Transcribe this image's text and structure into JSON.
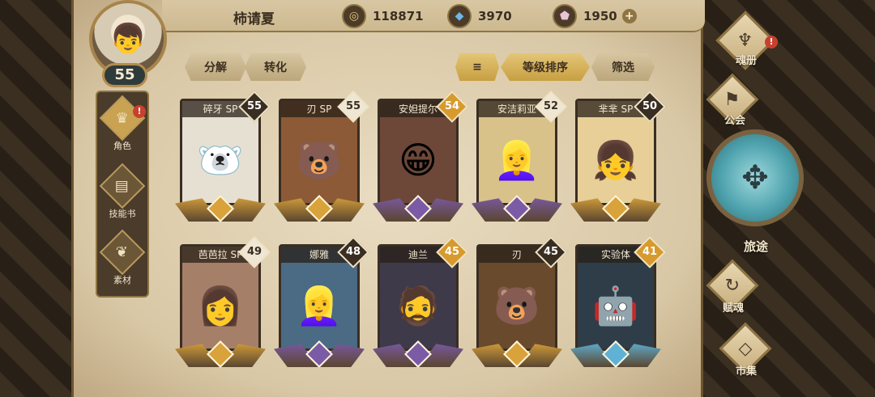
{
  "player": {
    "name": "柿请夏",
    "level": "55"
  },
  "currencies": [
    {
      "icon": "gold-coin-icon",
      "value": "118871"
    },
    {
      "icon": "blue-crystal-icon",
      "value": "3970"
    },
    {
      "icon": "pink-gem-icon",
      "value": "1950"
    }
  ],
  "left_menu": [
    {
      "label": "角色",
      "icon": "character-icon",
      "alert": "!"
    },
    {
      "label": "技能书",
      "icon": "skill-book-icon"
    },
    {
      "label": "素材",
      "icon": "material-icon"
    }
  ],
  "toolbar": {
    "decompose": "分解",
    "convert": "转化",
    "sort_level": "等级排序",
    "filter": "筛选"
  },
  "heroes": [
    {
      "name": "碎牙 SP",
      "level": "55",
      "level_color": "#3a2e22",
      "rarity": "gold",
      "bg": "#e6e0d2",
      "glyph": "🐻‍❄"
    },
    {
      "name": "刃 SP",
      "level": "55",
      "level_color": "#efe7d4",
      "rarity": "gold",
      "bg": "#8c5a36",
      "glyph": "🐻"
    },
    {
      "name": "安妲提尔",
      "level": "54",
      "level_color": "#d79a2c",
      "rarity": "purple",
      "bg": "#6d4738",
      "glyph": "😁"
    },
    {
      "name": "安洁莉亚",
      "level": "52",
      "level_color": "#efe7d4",
      "rarity": "purple",
      "bg": "#d9c18a",
      "glyph": "👱‍♀"
    },
    {
      "name": "芈芈 SP",
      "level": "50",
      "level_color": "#3a2e22",
      "rarity": "gold",
      "bg": "#e7cf97",
      "glyph": "👧"
    },
    {
      "name": "芭芭拉 SP",
      "level": "49",
      "level_color": "#efe7d4",
      "rarity": "gold",
      "bg": "#a67f68",
      "glyph": "👩"
    },
    {
      "name": "娜雅",
      "level": "48",
      "level_color": "#3a2e22",
      "rarity": "purple",
      "bg": "#4b6a84",
      "glyph": "👱‍♀"
    },
    {
      "name": "迪兰",
      "level": "45",
      "level_color": "#d79a2c",
      "rarity": "purple",
      "bg": "#3e3a4a",
      "glyph": "🧔"
    },
    {
      "name": "刃",
      "level": "45",
      "level_color": "#3a2e22",
      "rarity": "gold",
      "bg": "#6a4a2c",
      "glyph": "🐻"
    },
    {
      "name": "实验体",
      "level": "41",
      "level_color": "#d79a2c",
      "rarity": "blue",
      "bg": "#2f3d49",
      "glyph": "🤖"
    }
  ],
  "rarity_colors": {
    "gold": "#d9a23a",
    "purple": "#7b5aa6",
    "blue": "#5fb2d6"
  },
  "right_menu": {
    "soul_book": "魂册",
    "guild": "公会",
    "journey": "旅途",
    "talent": "赋魂",
    "market": "市集"
  }
}
